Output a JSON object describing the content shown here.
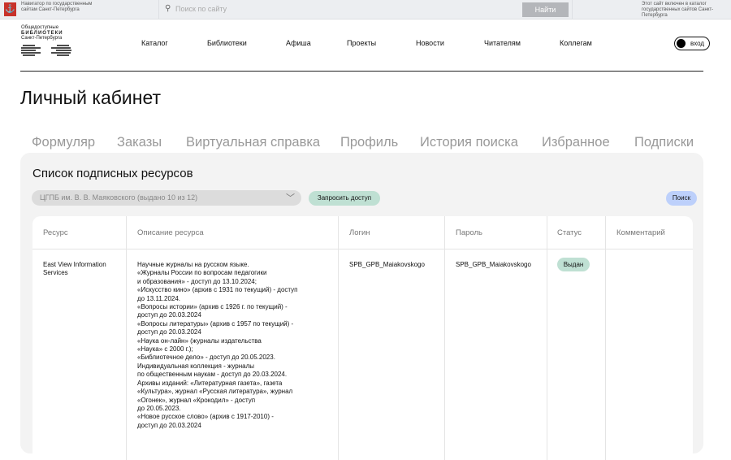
{
  "topbar": {
    "navigator": "Навигатор по государственным сайтам Санкт-Петербурга",
    "search_placeholder": "Поиск по сайту",
    "find": "Найти",
    "note": "Этот сайт включен в каталог государственных сайтов Санкт-Петербурга"
  },
  "logo": {
    "line1": "Общедоступные",
    "line2": "БИБЛИОТЕКИ",
    "line3": "Санкт-Петербурга"
  },
  "nav": [
    "Каталог",
    "Библиотеки",
    "Афиша",
    "Проекты",
    "Новости",
    "Читателям",
    "Коллегам"
  ],
  "login": "вход",
  "page_title": "Личный кабинет",
  "tabs": [
    "Формуляр",
    "Заказы",
    "Виртуальная справка",
    "Профиль",
    "История поиска",
    "Избранное",
    "Подписки"
  ],
  "panel": {
    "title": "Список подписных ресурсов",
    "select_value": "ЦГПБ им. В. В. Маяковского (выдано 10 из 12)",
    "request": "Запросить доступ",
    "search": "Поиск"
  },
  "table": {
    "headers": [
      "Ресурс",
      "Описание ресурса",
      "Логин",
      "Пароль",
      "Статус",
      "Комментарий"
    ],
    "rows": [
      {
        "resource": "East View Information Services",
        "description": "Научные журналы на русском языке.\n«Журналы России по вопросам педагогики\nи образования» - доступ до 13.10.2024;\n«Искусство кино» (архив с 1931 по текущий) - доступ\nдо 13.11.2024.\n«Вопросы истории» (архив с 1926 г. по текущий) -\nдоступ до 20.03.2024\n«Вопросы литературы» (архив с 1957 по текущий) -\nдоступ до 20.03.2024\n«Наука он-лайн» (журналы издательства\n«Наука» с 2000 г.);\n«Библиотечное дело» - доступ до 20.05.2023.\nИндивидуальная коллекция - журналы\nпо общественным наукам - доступ до 20.03.2024.\nАрхивы изданий: «Литературная газета», газета\n«Культура», журнал «Русская литература», журнал\n«Огонек», журнал «Крокодил» - доступ\nдо 20.05.2023.\n«Новое русское слово» (архив с 1917-2010) -\nдоступ до 20.03.2024",
        "login": "SPB_GPB_Maiakovskogo",
        "password": "SPB_GPB_Maiakovskogo",
        "status": "Выдан",
        "comment": ""
      }
    ]
  }
}
